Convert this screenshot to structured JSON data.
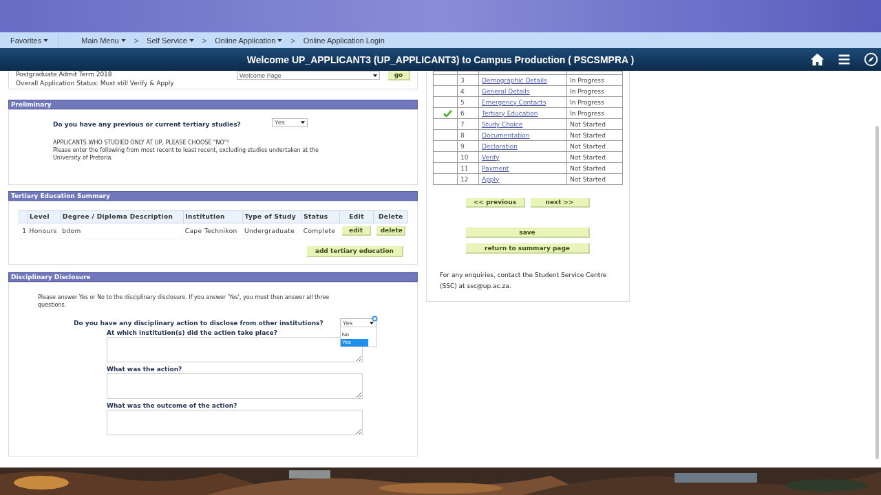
{
  "nav": {
    "items": [
      {
        "label": "Favorites",
        "dropdown": true
      },
      {
        "label": "Main Menu",
        "dropdown": true
      },
      {
        "label": "Self Service",
        "dropdown": true
      },
      {
        "label": "Online Application",
        "dropdown": true
      },
      {
        "label": "Online Application Login",
        "dropdown": false
      }
    ],
    "separator": ">"
  },
  "header": {
    "title": "Welcome UP_APPLICANT3 (UP_APPLICANT3) to Campus Production ( PSCSMPRA )"
  },
  "summary": {
    "term": "Postgraduate Admit Term 2018",
    "status": "Overall Application Status: Must still Verify & Apply",
    "page_select": "Welcome Page",
    "go_button": "go"
  },
  "preliminary": {
    "heading": "Preliminary",
    "question": "Do you have any previous or current tertiary studies?",
    "answer": "Yes",
    "note_lines": [
      "APPLICANTS WHO STUDIED ONLY AT UP, PLEASE CHOOSE \"NO\"!",
      "Please enter the following from most recent to least recent, excluding studies undertaken at the University of Pretoria."
    ]
  },
  "tertiary": {
    "heading": "Tertiary Education Summary",
    "columns": [
      "Level",
      "Degree / Diploma Description",
      "Institution",
      "Type of Study",
      "Status",
      "Edit",
      "Delete"
    ],
    "rows": [
      {
        "index": "1",
        "level": "Honours",
        "degree": "bdom",
        "institution": "Cape Technikon",
        "type": "Undergraduate",
        "status": "Complete",
        "edit": "edit",
        "delete": "delete"
      }
    ],
    "add_button": "add tertiary education"
  },
  "disciplinary": {
    "heading": "Disciplinary Disclosure",
    "intro": "Please answer Yes or No to the disciplinary disclosure. If you answer 'Yes', you must then answer all three questions.",
    "question": "Do you have any disciplinary action to disclose from other institutions?",
    "answer": "Yes",
    "options": [
      {
        "label": "No",
        "selected": false
      },
      {
        "label": "Yes",
        "selected": true
      }
    ],
    "fields": [
      "At which institution(s) did the action take place?",
      "What was the action?",
      "What was the outcome of the action?"
    ]
  },
  "steps": [
    {
      "number": "3",
      "label": "Demographic Details",
      "status": "In Progress",
      "current": false
    },
    {
      "number": "4",
      "label": "General Details",
      "status": "In Progress",
      "current": false
    },
    {
      "number": "5",
      "label": "Emergency Contacts",
      "status": "In Progress",
      "current": false
    },
    {
      "number": "6",
      "label": "Tertiary Education",
      "status": "In Progress",
      "current": true
    },
    {
      "number": "7",
      "label": "Study Choice",
      "status": "Not Started",
      "current": false
    },
    {
      "number": "8",
      "label": "Documentation",
      "status": "Not Started",
      "current": false
    },
    {
      "number": "9",
      "label": "Declaration",
      "status": "Not Started",
      "current": false
    },
    {
      "number": "10",
      "label": "Verify",
      "status": "Not Started",
      "current": false
    },
    {
      "number": "11",
      "label": "Payment",
      "status": "Not Started",
      "current": false
    },
    {
      "number": "12",
      "label": "Apply",
      "status": "Not Started",
      "current": false
    }
  ],
  "step_buttons": {
    "previous": "<< previous",
    "next": "next >>",
    "save": "save",
    "return": "return to summary page"
  },
  "enquiries": "For any enquiries, contact the Student Service Centre (SSC) at ssc@up.ac.za."
}
